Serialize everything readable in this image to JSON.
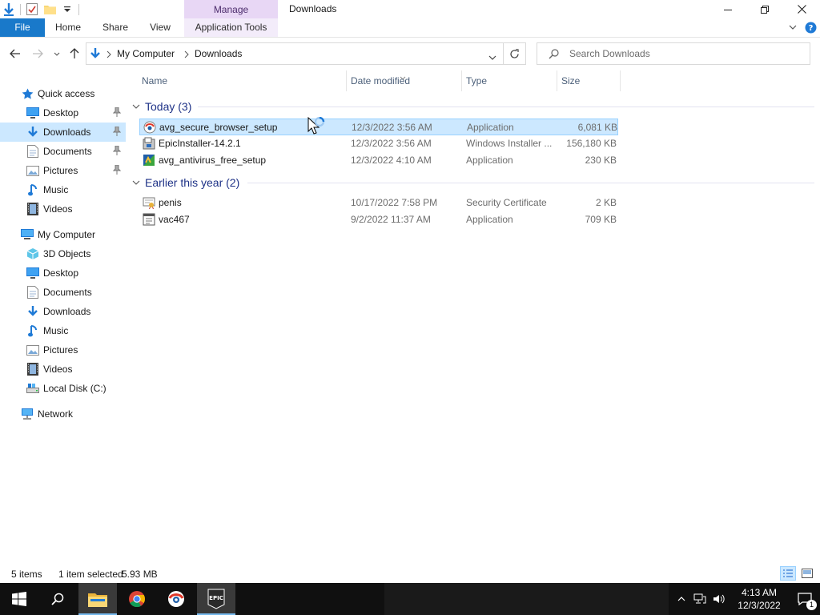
{
  "window": {
    "title": "Downloads",
    "context_tab_header": "Manage"
  },
  "ribbon": {
    "tabs": [
      {
        "label": "File"
      },
      {
        "label": "Home"
      },
      {
        "label": "Share"
      },
      {
        "label": "View"
      },
      {
        "label": "Application Tools"
      }
    ]
  },
  "address": {
    "crumbs": [
      "My Computer",
      "Downloads"
    ],
    "search_placeholder": "Search Downloads"
  },
  "sidebar": {
    "quick_access": {
      "label": "Quick access",
      "items": [
        {
          "label": "Desktop",
          "icon": "desktop-icon",
          "pinned": true
        },
        {
          "label": "Downloads",
          "icon": "downloads-icon",
          "pinned": true,
          "selected": true
        },
        {
          "label": "Documents",
          "icon": "documents-icon",
          "pinned": true
        },
        {
          "label": "Pictures",
          "icon": "pictures-icon",
          "pinned": true
        },
        {
          "label": "Music",
          "icon": "music-icon"
        },
        {
          "label": "Videos",
          "icon": "videos-icon"
        }
      ]
    },
    "my_computer": {
      "label": "My Computer",
      "items": [
        {
          "label": "3D Objects",
          "icon": "3d-objects-icon"
        },
        {
          "label": "Desktop",
          "icon": "desktop-icon"
        },
        {
          "label": "Documents",
          "icon": "documents-icon"
        },
        {
          "label": "Downloads",
          "icon": "downloads-icon"
        },
        {
          "label": "Music",
          "icon": "music-icon"
        },
        {
          "label": "Pictures",
          "icon": "pictures-icon"
        },
        {
          "label": "Videos",
          "icon": "videos-icon"
        },
        {
          "label": "Local Disk (C:)",
          "icon": "local-disk-icon"
        }
      ]
    },
    "network": {
      "label": "Network"
    }
  },
  "columns": {
    "name": "Name",
    "date": "Date modified",
    "type": "Type",
    "size": "Size"
  },
  "groups": [
    {
      "label": "Today (3)",
      "files": [
        {
          "name": "avg_secure_browser_setup",
          "date": "12/3/2022 3:56 AM",
          "type": "Application",
          "size": "6,081 KB",
          "icon": "avg-browser-icon",
          "selected": true
        },
        {
          "name": "EpicInstaller-14.2.1",
          "date": "12/3/2022 3:56 AM",
          "type": "Windows Installer ...",
          "size": "156,180 KB",
          "icon": "msi-installer-icon"
        },
        {
          "name": "avg_antivirus_free_setup",
          "date": "12/3/2022 4:10 AM",
          "type": "Application",
          "size": "230 KB",
          "icon": "avg-antivirus-icon"
        }
      ]
    },
    {
      "label": "Earlier this year (2)",
      "files": [
        {
          "name": "penis",
          "date": "10/17/2022 7:58 PM",
          "type": "Security Certificate",
          "size": "2 KB",
          "icon": "certificate-icon"
        },
        {
          "name": "vac467",
          "date": "9/2/2022 11:37 AM",
          "type": "Application",
          "size": "709 KB",
          "icon": "application-icon"
        }
      ]
    }
  ],
  "status": {
    "items": "5 items",
    "selected": "1 item selected",
    "size": "5.93 MB"
  },
  "taskbar": {
    "time": "4:13 AM",
    "date": "12/3/2022",
    "notifications": "1",
    "epic_label": "EPIC"
  },
  "colors": {
    "accent": "#1979ca",
    "selection": "#cce8ff",
    "context_tab": "#e8d7f5",
    "group_header": "#1e3287"
  }
}
